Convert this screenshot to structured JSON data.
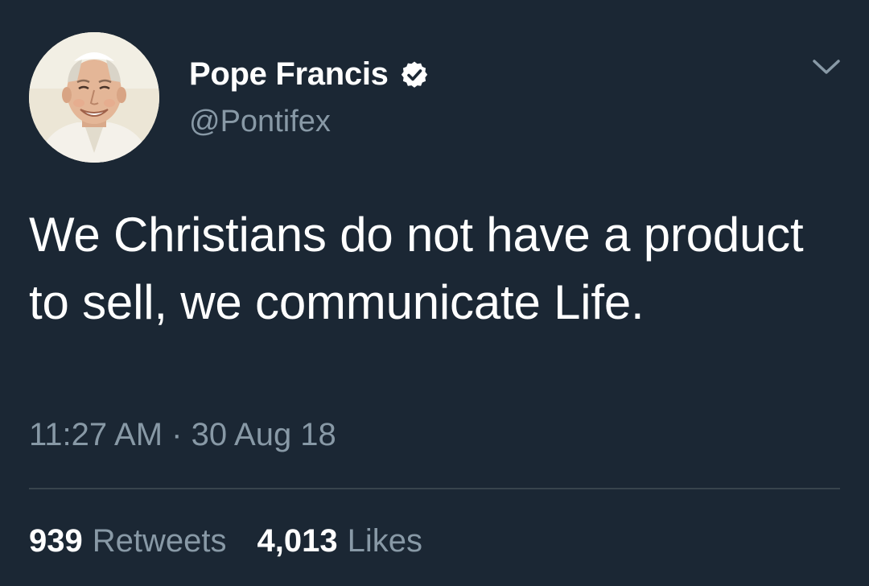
{
  "author": {
    "display_name": "Pope Francis",
    "handle": "@Pontifex",
    "verified": true,
    "avatar_icon": "profile-photo"
  },
  "tweet": {
    "text": "We Christians do not have a product to sell, we communicate Life.",
    "time": "11:27 AM",
    "separator": "·",
    "date": "30 Aug 18"
  },
  "stats": {
    "retweets_count": "939",
    "retweets_label": "Retweets",
    "likes_count": "4,013",
    "likes_label": "Likes"
  },
  "menu": {
    "icon": "chevron-down-icon"
  },
  "colors": {
    "background": "#1b2734",
    "primary_text": "#ffffff",
    "secondary_text": "#8899a6",
    "divider": "#38444d"
  }
}
